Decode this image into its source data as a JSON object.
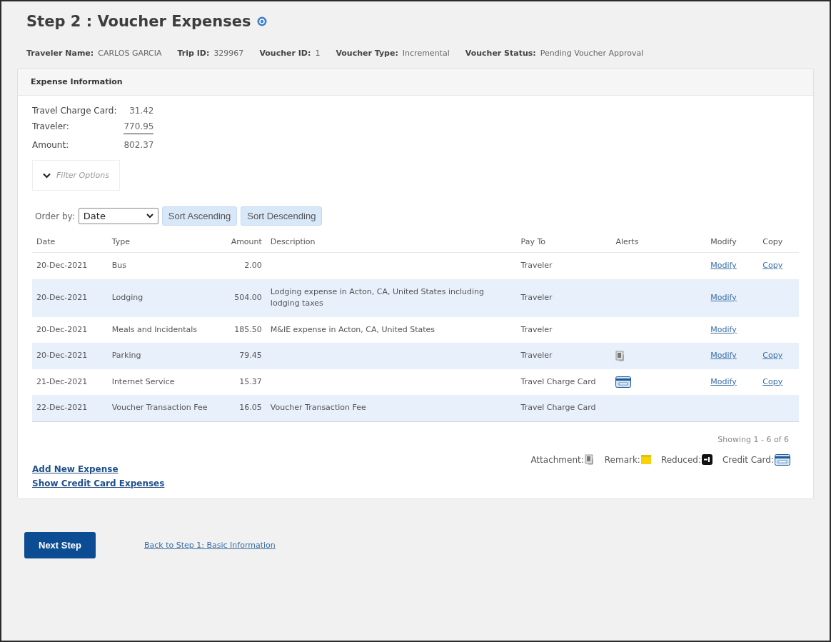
{
  "title": "Step 2 : Voucher Expenses",
  "info": [
    {
      "label": "Traveler Name:",
      "value": "CARLOS GARCIA"
    },
    {
      "label": "Trip ID:",
      "value": "329967"
    },
    {
      "label": "Voucher ID:",
      "value": "1"
    },
    {
      "label": "Voucher Type:",
      "value": "Incremental"
    },
    {
      "label": "Voucher Status:",
      "value": "Pending Voucher Approval"
    }
  ],
  "panel": {
    "title": "Expense Information",
    "totals": [
      {
        "label": "Travel Charge Card:",
        "value": "31.42",
        "underline": false
      },
      {
        "label": "Traveler:",
        "value": "770.95",
        "underline": true
      },
      {
        "label": "Amount:",
        "value": "802.37",
        "underline": false
      }
    ],
    "filter": {
      "label": "Filter Options",
      "expanded": false
    },
    "order_by": {
      "label": "Order by:",
      "value": "Date"
    },
    "sort_buttons": [
      "Sort Ascending",
      "Sort Descending"
    ],
    "columns": [
      "Date",
      "Type",
      "Amount",
      "Description",
      "Pay To",
      "Alerts",
      "Modify",
      "Copy"
    ],
    "rows": [
      {
        "date": "20-Dec-2021",
        "type": "Bus",
        "amount": "2.00",
        "description": "",
        "pay_to": "Traveler",
        "alerts": [],
        "modify": "Modify",
        "copy": "Copy"
      },
      {
        "date": "20-Dec-2021",
        "type": "Lodging",
        "amount": "504.00",
        "description": "Lodging expense in Acton, CA, United States including lodging taxes",
        "pay_to": "Traveler",
        "alerts": [],
        "modify": "Modify"
      },
      {
        "date": "20-Dec-2021",
        "type": "Meals and Incidentals",
        "amount": "185.50",
        "description": "M&IE expense in Acton, CA, United States",
        "pay_to": "Traveler",
        "alerts": [],
        "modify": "Modify"
      },
      {
        "date": "20-Dec-2021",
        "type": "Parking",
        "amount": "79.45",
        "description": "",
        "pay_to": "Traveler",
        "alerts": [
          {
            "kind": "attachment"
          }
        ],
        "modify": "Modify",
        "copy": "Copy"
      },
      {
        "date": "21-Dec-2021",
        "type": "Internet Service",
        "amount": "15.37",
        "description": "",
        "pay_to": "Travel Charge Card",
        "alerts": [
          {
            "kind": "credit_card"
          }
        ],
        "modify": "Modify",
        "copy": "Copy"
      },
      {
        "date": "22-Dec-2021",
        "type": "Voucher Transaction Fee",
        "amount": "16.05",
        "description": "Voucher Transaction Fee",
        "pay_to": "Travel Charge Card",
        "alerts": []
      }
    ],
    "showing": "Showing 1 - 6 of 6",
    "legend": [
      {
        "label": "Attachment:",
        "kind": "attachment"
      },
      {
        "label": "Remark:",
        "kind": "remark"
      },
      {
        "label": "Reduced:",
        "kind": "reduced"
      },
      {
        "label": "Credit Card:",
        "kind": "credit_card"
      }
    ],
    "links": [
      "Add New Expense",
      "Show Credit Card Expenses"
    ]
  },
  "next_button": "Next Step",
  "back_link": "Back to Step 1: Basic Information"
}
